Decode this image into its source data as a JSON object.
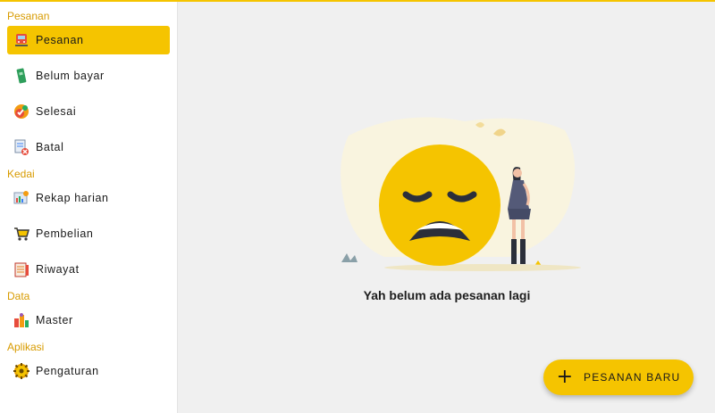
{
  "sidebar": {
    "sections": [
      {
        "label": "Pesanan"
      },
      {
        "label": "Kedai"
      },
      {
        "label": "Data"
      },
      {
        "label": "Aplikasi"
      }
    ],
    "items": [
      {
        "label": "Pesanan",
        "icon": "train-icon",
        "active": true
      },
      {
        "label": "Belum bayar",
        "icon": "cash-icon"
      },
      {
        "label": "Selesai",
        "icon": "check-badge-icon"
      },
      {
        "label": "Batal",
        "icon": "cancel-document-icon"
      },
      {
        "label": "Rekap harian",
        "icon": "report-icon"
      },
      {
        "label": "Pembelian",
        "icon": "shopping-cart-icon"
      },
      {
        "label": "Riwayat",
        "icon": "history-icon"
      },
      {
        "label": "Master",
        "icon": "products-icon"
      },
      {
        "label": "Pengaturan",
        "icon": "gear-icon"
      }
    ]
  },
  "main": {
    "empty_state_text": "Yah belum ada pesanan lagi",
    "fab_label": "PESANAN BARU"
  },
  "colors": {
    "accent": "#f5c400",
    "section_label": "#d89b00",
    "background": "#f0f0f0"
  }
}
